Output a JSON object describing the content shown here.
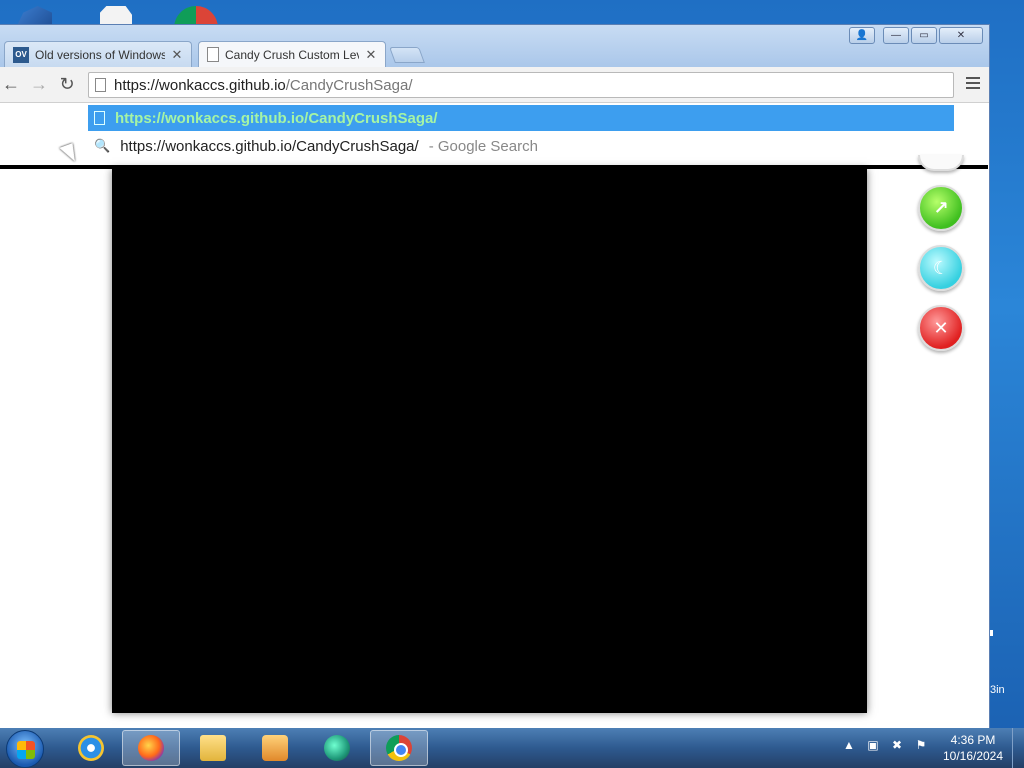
{
  "browser": {
    "tabs": [
      {
        "title": "Old versions of Windows",
        "favicon": "OV"
      },
      {
        "title": "Candy Crush Custom Leve"
      }
    ],
    "omnibox": {
      "url_host": "https://wonkaccs.github.io",
      "url_path": "/CandyCrushSaga/"
    },
    "suggestions": [
      {
        "text": "https://wonkaccs.github.io/CandyCrushSaga/"
      },
      {
        "text": "https://wonkaccs.github.io/CandyCrushSaga/",
        "hint": "- Google Search"
      }
    ]
  },
  "desktop": {
    "side_label": "3in"
  },
  "taskbar": {
    "clock_time": "4:36 PM",
    "clock_date": "10/16/2024"
  },
  "colors": {
    "selection": "#3d9eef",
    "selection_text": "#a5f4a5",
    "taskbar": "#2e5a8f"
  }
}
